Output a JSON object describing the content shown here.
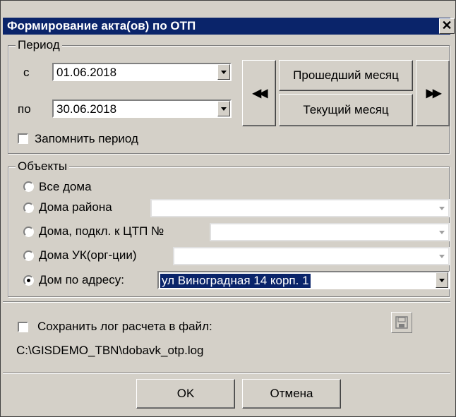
{
  "window": {
    "title": "Формирование акта(ов) по ОТП",
    "close_glyph": "✕"
  },
  "period": {
    "legend": "Период",
    "from_label": "с",
    "from_value": "01.06.2018",
    "to_label": "по",
    "to_value": "30.06.2018",
    "prev_glyph": "◀◀",
    "next_glyph": "▶▶",
    "last_month_label": "Прошедший месяц",
    "current_month_label": "Текущий месяц",
    "remember_label": "Запомнить период",
    "remember_checked": false
  },
  "objects": {
    "legend": "Объекты",
    "options": [
      {
        "label": "Все дома",
        "checked": false,
        "value": ""
      },
      {
        "label": "Дома района",
        "checked": false,
        "value": ""
      },
      {
        "label": "Дома, подкл. к ЦТП №",
        "checked": false,
        "value": ""
      },
      {
        "label": "Дома УК(орг-ции)",
        "checked": false,
        "value": ""
      },
      {
        "label": "Дом по адресу:",
        "checked": true,
        "value": "ул Виноградная 14 корп. 1"
      }
    ]
  },
  "log": {
    "save_label": "Сохранить лог расчета в файл:",
    "save_checked": false,
    "path": "C:\\GISDEMO_TBN\\dobavk_otp.log",
    "save_icon": "floppy-disk-icon"
  },
  "footer": {
    "ok_label": "OK",
    "cancel_label": "Отмена"
  }
}
